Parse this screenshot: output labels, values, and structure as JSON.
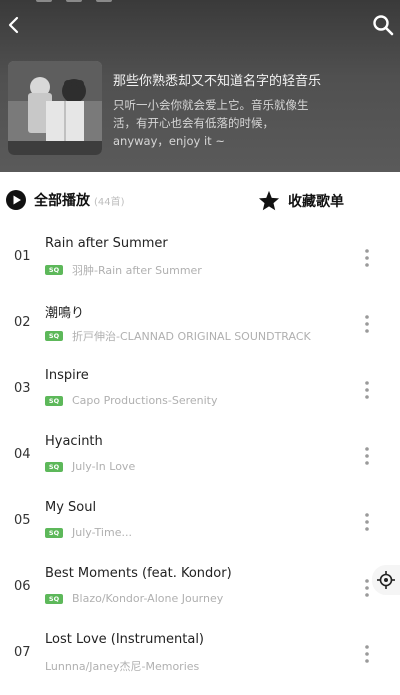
{
  "header": {
    "title": "那些你熟悉却又不知道名字的轻音乐",
    "description": "只听一小会你就会爱上它。音乐就像生活，有开心也会有低落的时候，anyway，enjoy it ~"
  },
  "actions": {
    "play_all_label": "全部播放",
    "play_all_count": "(44首)",
    "favorite_label": "收藏歌单"
  },
  "songs": [
    {
      "num": "01",
      "title": "Rain after Summer",
      "artist": "羽肿-Rain after Summer",
      "sq": true
    },
    {
      "num": "02",
      "title": "潮鳴り",
      "artist": "折戸伸治-CLANNAD ORIGINAL SOUNDTRACK",
      "sq": true
    },
    {
      "num": "03",
      "title": "Inspire",
      "artist": "Capo Productions-Serenity",
      "sq": true
    },
    {
      "num": "04",
      "title": "Hyacinth",
      "artist": "July-In Love",
      "sq": true
    },
    {
      "num": "05",
      "title": "My Soul",
      "artist": "July-Time...",
      "sq": true
    },
    {
      "num": "06",
      "title": "Best Moments (feat. Kondor)",
      "artist": "Blazo/Kondor-Alone Journey",
      "sq": true
    },
    {
      "num": "07",
      "title": "Lost Love (Instrumental)",
      "artist": "Lunnna/Janey杰尼-Memories",
      "sq": false
    }
  ],
  "sq_badge": "SQ",
  "colors": {
    "sq_green": "#5db85a",
    "header_bg": "#4a4a4a"
  }
}
